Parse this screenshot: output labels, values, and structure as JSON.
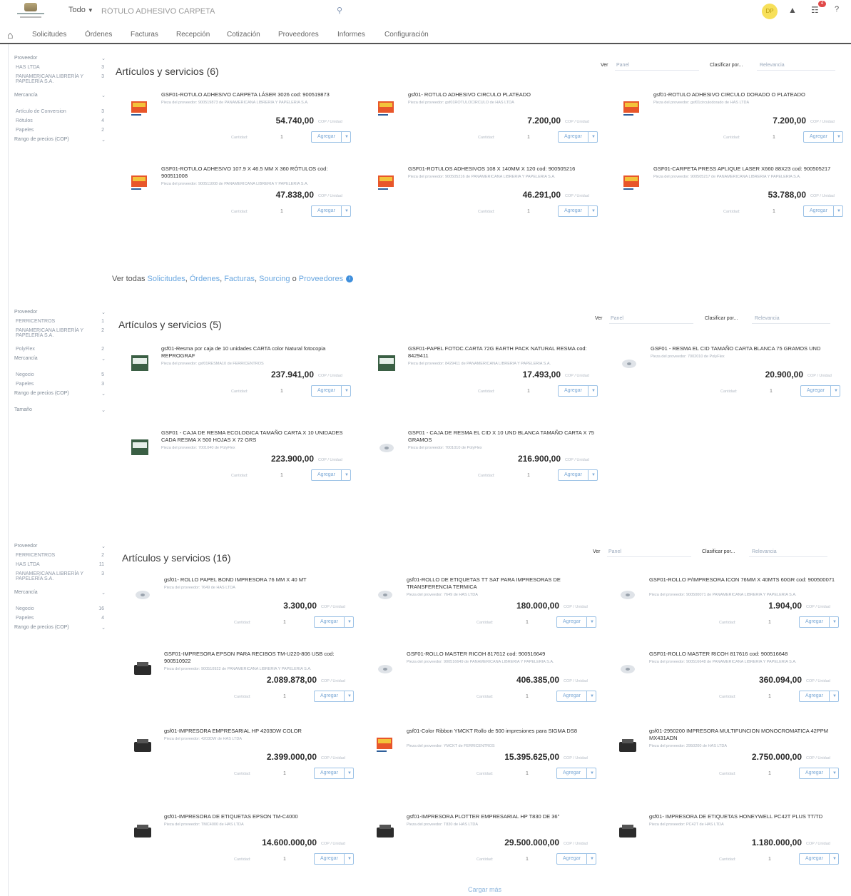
{
  "header": {
    "category": "Todo",
    "search_value": "RÓTULO ADHESIVO CARPETA",
    "avatar_initials": "DP",
    "cart_count": "4"
  },
  "nav": [
    "Solicitudes",
    "Órdenes",
    "Facturas",
    "Recepción",
    "Cotización",
    "Proveedores",
    "Informes",
    "Configuración"
  ],
  "sections": [
    {
      "title": "Artículos y servicios (6)",
      "view_label": "Ver",
      "view_value": "Panel",
      "sort_label": "Clasificar por...",
      "sort_value": "Relevancia",
      "filters": [
        {
          "text": "Proveedor",
          "count": "",
          "head": true
        },
        {
          "text": "HAS LTDA",
          "count": "3",
          "head": false
        },
        {
          "text": "PANAMERICANA LIBRERÍA Y PAPELERÍA S.A.",
          "count": "3",
          "head": false
        },
        {
          "text": "Mercancía",
          "count": "",
          "head": true
        },
        {
          "text": "Artículo de Conversion",
          "count": "3",
          "head": false
        },
        {
          "text": "Rótulos",
          "count": "4",
          "head": false
        },
        {
          "text": "Papeles",
          "count": "2",
          "head": false
        },
        {
          "text": "Rango de precios (COP)",
          "count": "",
          "head": true
        }
      ],
      "products": [
        {
          "title": "GSF01-ROTULO ADHESIVO CARPETA LÁSER 3026 cod: 900519873",
          "supplier": "Pieza del proveedor: 900519873 de PANAMERICANA LIBRERÍA Y PAPELERÍA S.A.",
          "price": "54.740,00",
          "unit": "COP / Unidad",
          "qty_label": "Cantidad:",
          "qty": "1",
          "add": "Agregar"
        },
        {
          "title": "gsf01- ROTULO ADHESIVO CIRCULO PLATEADO",
          "supplier": "Pieza del proveedor: gsf01ROTULOCIRCULO de HAS LTDA",
          "price": "7.200,00",
          "unit": "COP / Unidad",
          "qty_label": "Cantidad:",
          "qty": "1",
          "add": "Agregar"
        },
        {
          "title": "gsf01-ROTULO ADHESIVO CIRCULO DORADO O PLATEADO",
          "supplier": "Pieza del proveedor: gsf01circulodorado de HAS LTDA",
          "price": "7.200,00",
          "unit": "COP / Unidad",
          "qty_label": "Cantidad:",
          "qty": "1",
          "add": "Agregar"
        },
        {
          "title": "GSF01-ROTULO ADHESIVO 107.9 X 46.5 MM X 360 RÓTULOS cod: 900511008",
          "supplier": "Pieza del proveedor: 900511008 de PANAMERICANA LIBRERÍA Y PAPELERÍA S.A.",
          "price": "47.838,00",
          "unit": "COP / Unidad",
          "qty_label": "Cantidad:",
          "qty": "1",
          "add": "Agregar"
        },
        {
          "title": "GSF01-ROTULOS ADHESIVOS 108 X 140MM X 120 cod: 900505216",
          "supplier": "Pieza del proveedor: 900505216 de PANAMERICANA LIBRERÍA Y PAPELERÍA S.A.",
          "price": "46.291,00",
          "unit": "COP / Unidad",
          "qty_label": "Cantidad:",
          "qty": "1",
          "add": "Agregar"
        },
        {
          "title": "GSF01-CARPETA PRESS APLIQUE LASER X660 88X23 cod: 900505217",
          "supplier": "Pieza del proveedor: 900505217 de PANAMERICANA LIBRERÍA Y PAPELERÍA S.A.",
          "price": "53.788,00",
          "unit": "COP / Unidad",
          "qty_label": "Cantidad:",
          "qty": "1",
          "add": "Agregar"
        }
      ]
    },
    {
      "title": "Artículos y servicios (5)",
      "view_label": "Ver",
      "view_value": "Panel",
      "sort_label": "Clasificar por...",
      "sort_value": "Relevancia",
      "filters": [
        {
          "text": "Proveedor",
          "count": "",
          "head": true
        },
        {
          "text": "FERRICENTROS",
          "count": "1",
          "head": false
        },
        {
          "text": "PANAMERICANA LIBRERÍA Y PAPELERÍA S.A.",
          "count": "2",
          "head": false
        },
        {
          "text": "PolyFlex",
          "count": "2",
          "head": false
        },
        {
          "text": "Mercancía",
          "count": "",
          "head": true
        },
        {
          "text": "Negocio",
          "count": "5",
          "head": false
        },
        {
          "text": "Papeles",
          "count": "3",
          "head": false
        },
        {
          "text": "Rango de precios (COP)",
          "count": "",
          "head": true
        },
        {
          "text": "Tamaño",
          "count": "",
          "head": true
        }
      ],
      "products": [
        {
          "title": "gsf01-Resma por caja de 10 unidades CARTA color Natural fotocopia REPROGRAF",
          "supplier": "Pieza del proveedor: gsf01RESMA10 de FERRICENTROS",
          "price": "237.941,00",
          "unit": "COP / Unidad",
          "qty_label": "Cantidad:",
          "qty": "1",
          "add": "Agregar"
        },
        {
          "title": "GSF01-PAPEL FOTOC.CARTA 72G EARTH PACK NATURAL RESMA cod: 8429411",
          "supplier": "Pieza del proveedor: 8429411 de PANAMERICANA LIBRERÍA Y PAPELERÍA S.A.",
          "price": "17.493,00",
          "unit": "COP / Unidad",
          "qty_label": "Cantidad:",
          "qty": "1",
          "add": "Agregar"
        },
        {
          "title": "GSF01 - RESMA EL CID TAMAÑO CARTA BLANCA 75 GRAMOS UND",
          "supplier": "Pieza del proveedor: 7002010 de PolyFlex",
          "price": "20.900,00",
          "unit": "COP / Unidad",
          "qty_label": "Cantidad:",
          "qty": "1",
          "add": "Agregar"
        },
        {
          "title": "GSF01 - CAJA DE RESMA ECOLOGICA TAMAÑO CARTA X 10 UNIDADES CADA RESMA X 500 HOJAS X 72 GRS",
          "supplier": "Pieza del proveedor: 7001040 de PolyFlex",
          "price": "223.900,00",
          "unit": "COP / Unidad",
          "qty_label": "Cantidad:",
          "qty": "1",
          "add": "Agregar"
        },
        {
          "title": "GSF01 - CAJA DE RESMA EL CID X 10 UND BLANCA TAMAÑO CARTA X 75 GRAMOS",
          "supplier": "Pieza del proveedor: 7001010 de PolyFlex",
          "price": "216.900,00",
          "unit": "COP / Unidad",
          "qty_label": "Cantidad:",
          "qty": "1",
          "add": "Agregar"
        }
      ]
    },
    {
      "title": "Artículos y servicios (16)",
      "view_label": "Ver",
      "view_value": "Panel",
      "sort_label": "Clasificar por...",
      "sort_value": "Relevancia",
      "filters": [
        {
          "text": "Proveedor",
          "count": "",
          "head": true
        },
        {
          "text": "FERRICENTROS",
          "count": "2",
          "head": false
        },
        {
          "text": "HAS LTDA",
          "count": "11",
          "head": false
        },
        {
          "text": "PANAMERICANA LIBRERÍA Y PAPELERÍA S.A.",
          "count": "3",
          "head": false
        },
        {
          "text": "Mercancía",
          "count": "",
          "head": true
        },
        {
          "text": "Negocio",
          "count": "16",
          "head": false
        },
        {
          "text": "Papeles",
          "count": "4",
          "head": false
        },
        {
          "text": "Rango de precios (COP)",
          "count": "",
          "head": true
        }
      ],
      "products": [
        {
          "title": "gsf01- ROLLO PAPEL BOND IMPRESORA 76 MM X 40 MT",
          "supplier": "Pieza del proveedor: 7649 de HAS LTDA",
          "price": "3.300,00",
          "unit": "COP / Unidad",
          "qty_label": "Cantidad:",
          "qty": "1",
          "add": "Agregar"
        },
        {
          "title": "gsf01-ROLLO DE ETIQUETAS TT SAT PARA IMPRESORAS DE TRANSFERENCIA TERMICA",
          "supplier": "Pieza del proveedor: 7649 de HAS LTDA",
          "price": "180.000,00",
          "unit": "COP / Unidad",
          "qty_label": "Cantidad:",
          "qty": "1",
          "add": "Agregar"
        },
        {
          "title": "GSF01-ROLLO P/IMPRESORA ICON 76MM X 40MTS 60GR cod: 900500071",
          "supplier": "Pieza del proveedor: 900500071 de PANAMERICANA LIBRERÍA Y PAPELERÍA S.A.",
          "price": "1.904,00",
          "unit": "COP / Unidad",
          "qty_label": "Cantidad:",
          "qty": "1",
          "add": "Agregar"
        },
        {
          "title": "GSF01-IMPRESORA EPSON PARA RECIBOS TM-U220-806 USB cod: 900510922",
          "supplier": "Pieza del proveedor: 900510922 de PANAMERICANA LIBRERÍA Y PAPELERÍA S.A.",
          "price": "2.089.878,00",
          "unit": "COP / Unidad",
          "qty_label": "Cantidad:",
          "qty": "1",
          "add": "Agregar"
        },
        {
          "title": "GSF01-ROLLO MASTER RICOH 817612 cod: 900516649",
          "supplier": "Pieza del proveedor: 900516649 de PANAMERICANA LIBRERÍA Y PAPELERÍA S.A.",
          "price": "406.385,00",
          "unit": "COP / Unidad",
          "qty_label": "Cantidad:",
          "qty": "1",
          "add": "Agregar"
        },
        {
          "title": "GSF01-ROLLO MASTER RICOH 817616 cod: 900516648",
          "supplier": "Pieza del proveedor: 900516648 de PANAMERICANA LIBRERÍA Y PAPELERÍA S.A.",
          "price": "360.094,00",
          "unit": "COP / Unidad",
          "qty_label": "Cantidad:",
          "qty": "1",
          "add": "Agregar"
        },
        {
          "title": "gsf01-IMPRESORA EMPRESARIAL HP 4203DW COLOR",
          "supplier": "Pieza del proveedor: 4203DW de HAS LTDA",
          "price": "2.399.000,00",
          "unit": "COP / Unidad",
          "qty_label": "Cantidad:",
          "qty": "1",
          "add": "Agregar"
        },
        {
          "title": "gsf01-Color Ribbon YMCKT Rollo de 500 impresiones para SIGMA DS8",
          "supplier": "Pieza del proveedor: YMCKT de FERRICENTROS",
          "price": "15.395.625,00",
          "unit": "COP / Unidad",
          "qty_label": "Cantidad:",
          "qty": "1",
          "add": "Agregar"
        },
        {
          "title": "gsf01-2950200 IMPRESORA MULTIFUNCION MONOCROMATICA 42PPM MX431ADN",
          "supplier": "Pieza del proveedor: 2950200 de HAS LTDA",
          "price": "2.750.000,00",
          "unit": "COP / Unidad",
          "qty_label": "Cantidad:",
          "qty": "1",
          "add": "Agregar"
        },
        {
          "title": "gsf01-IMPRESORA DE ETIQUETAS EPSON TM-C4000",
          "supplier": "Pieza del proveedor: TMC4000 de HAS LTDA",
          "price": "14.600.000,00",
          "unit": "COP / Unidad",
          "qty_label": "Cantidad:",
          "qty": "1",
          "add": "Agregar"
        },
        {
          "title": "gsf01-IMPRESORA PLOTTER EMPRESARIAL HP T830 DE 36\"",
          "supplier": "Pieza del proveedor: T830 de HAS LTDA",
          "price": "29.500.000,00",
          "unit": "COP / Unidad",
          "qty_label": "Cantidad:",
          "qty": "1",
          "add": "Agregar"
        },
        {
          "title": "gsf01- IMPRESORA DE ETIQUETAS HONEYWELL PC42T PLUS TT/TD",
          "supplier": "Pieza del proveedor: PC42T de HAS LTDA",
          "price": "1.180.000,00",
          "unit": "COP / Unidad",
          "qty_label": "Cantidad:",
          "qty": "1",
          "add": "Agregar"
        }
      ]
    }
  ],
  "see_all": {
    "prefix": "Ver todas",
    "links": [
      "Solicitudes",
      "Órdenes",
      "Facturas",
      "Sourcing"
    ],
    "separator": ",",
    "or": "o",
    "last_link": "Proveedores"
  },
  "load_more": "Cargar más",
  "colors": {
    "accent": "#6aa7e0",
    "avatar": "#f7e05a",
    "badge": "#e04848"
  }
}
